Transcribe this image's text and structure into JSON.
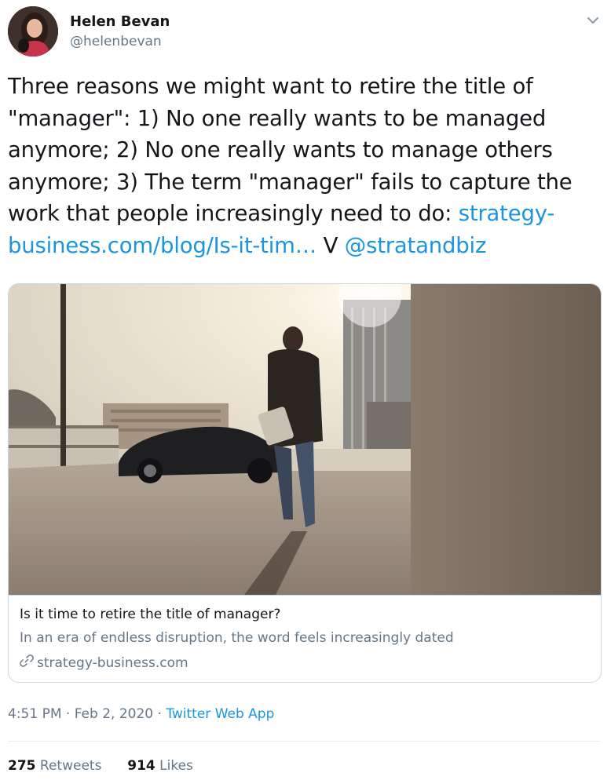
{
  "tweet": {
    "author": {
      "name": "Helen Bevan",
      "handle": "@helenbevan"
    },
    "text_plain": "Three reasons we might want to retire the title of \"manager\": 1) No one really wants to be managed anymore; 2) No one really wants to manage others anymore; 3) The term \"manager\" fails to capture the work that people increasingly need to do: ",
    "link_text": "strategy-business.com/blog/Is-it-tim…",
    "via_text": " V ",
    "mention": "@stratandbiz",
    "card": {
      "title": "Is it time to retire the title of manager?",
      "description": "In an era of endless disruption, the word feels increasingly dated",
      "domain": "strategy-business.com"
    },
    "timestamp": "4:51 PM · Feb 2, 2020 · ",
    "source": "Twitter Web App",
    "retweets_count": "275",
    "retweets_label": "Retweets",
    "likes_count": "914",
    "likes_label": "Likes"
  },
  "icons": {
    "caret": "chevron-down-icon",
    "link": "link-icon"
  },
  "colors": {
    "text": "#14171a",
    "secondary": "#657786",
    "link": "#1b95e0",
    "border": "#ccd6dd"
  }
}
